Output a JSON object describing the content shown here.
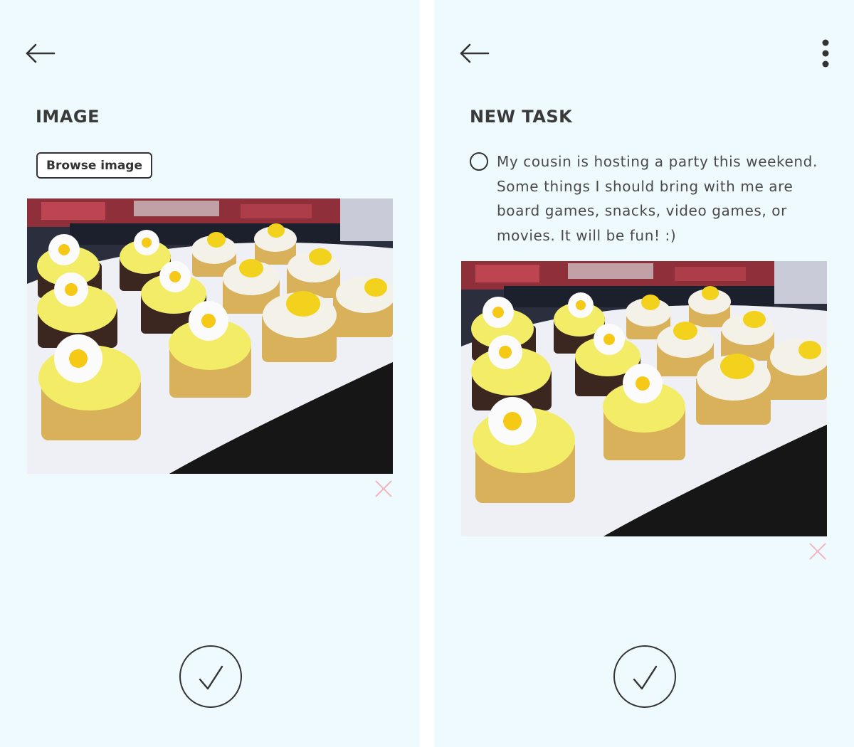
{
  "left_screen": {
    "section_title": "IMAGE",
    "browse_button_label": "Browse image",
    "image_alt": "Cupcakes with daisy and bee decorations on a white platter"
  },
  "right_screen": {
    "section_title": "NEW TASK",
    "task_text": "My cousin is hosting a party this weekend. Some things I should bring with me are board games, snacks, video games, or movies. It will be fun! :)",
    "image_alt": "Cupcakes with daisy and bee decorations on a white platter"
  },
  "icons": {
    "back": "arrow-left-icon",
    "more": "more-vertical-icon",
    "remove": "close-icon",
    "confirm": "checkmark-icon"
  },
  "colors": {
    "background": "#effafe",
    "remove_icon": "#f4b6c0",
    "text": "#3a3a3a"
  }
}
